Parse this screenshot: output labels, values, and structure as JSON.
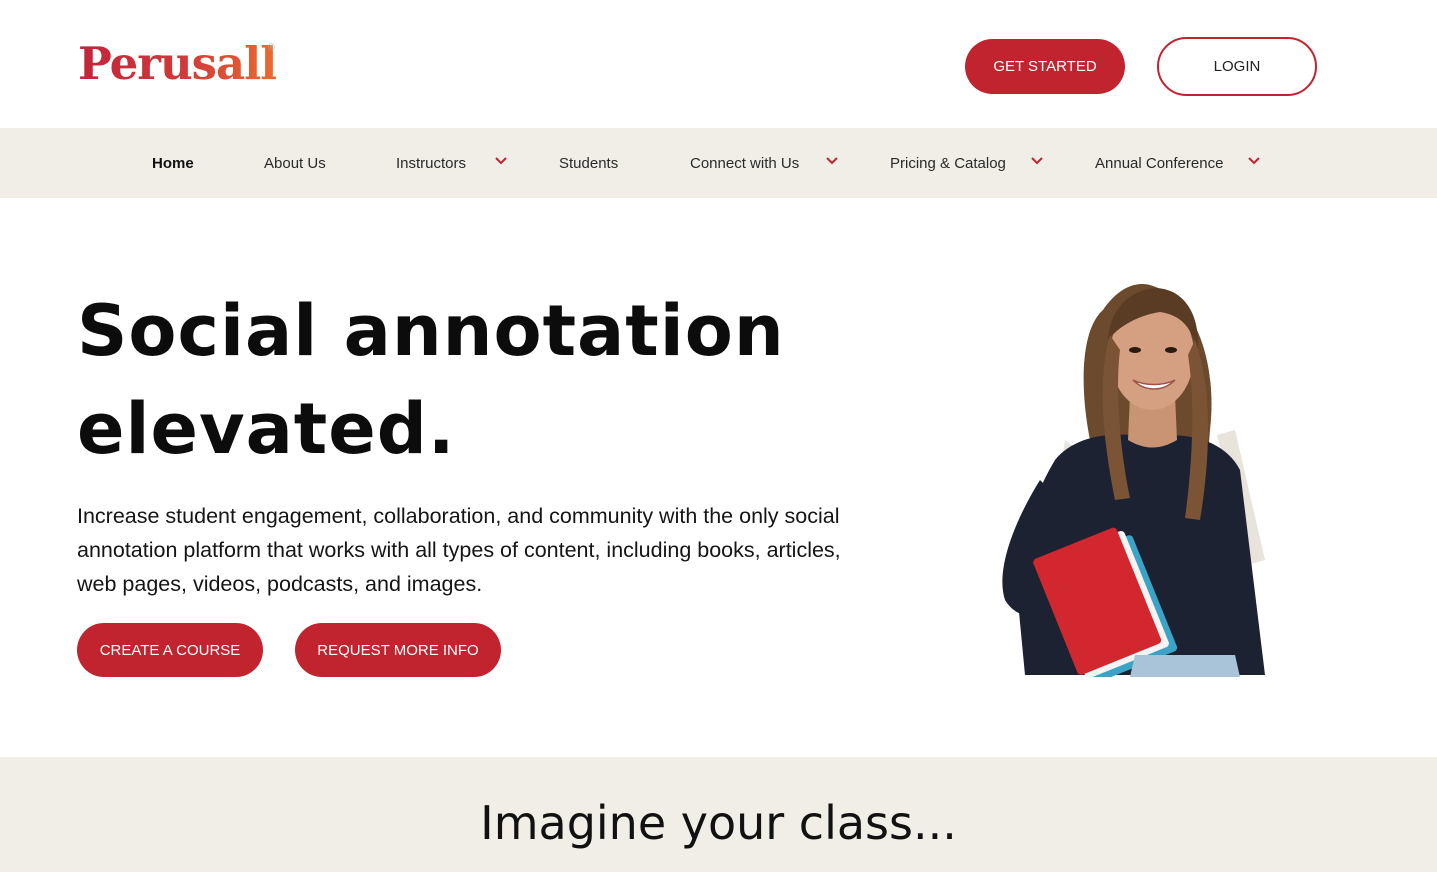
{
  "header": {
    "logo_text": "Perusall",
    "logo_mark": "®",
    "get_started_label": "GET STARTED",
    "login_label": "LOGIN"
  },
  "nav": {
    "items": [
      {
        "label": "Home",
        "active": true,
        "has_dropdown": false
      },
      {
        "label": "About Us",
        "active": false,
        "has_dropdown": false
      },
      {
        "label": "Instructors",
        "active": false,
        "has_dropdown": true
      },
      {
        "label": "Students",
        "active": false,
        "has_dropdown": false
      },
      {
        "label": "Connect with Us",
        "active": false,
        "has_dropdown": true
      },
      {
        "label": "Pricing & Catalog",
        "active": false,
        "has_dropdown": true
      },
      {
        "label": "Annual Conference",
        "active": false,
        "has_dropdown": true
      }
    ],
    "dropdown_icon": "chevron-down-icon"
  },
  "hero": {
    "title_line1": "Social annotation",
    "title_line2": "elevated.",
    "subtitle": "Increase student engagement, collaboration, and community with the only social annotation platform that works with all types of content,  including books, articles, web pages, videos, podcasts, and images.",
    "create_course_label": "CREATE A COURSE",
    "request_info_label": "REQUEST MORE INFO",
    "image": "student-with-notebooks-photo"
  },
  "imagine": {
    "title": "Imagine your class..."
  },
  "colors": {
    "brand_red": "#c1232f",
    "brand_orange": "#ec6a2e",
    "nav_bg": "#f1eee8",
    "text": "#111111"
  }
}
